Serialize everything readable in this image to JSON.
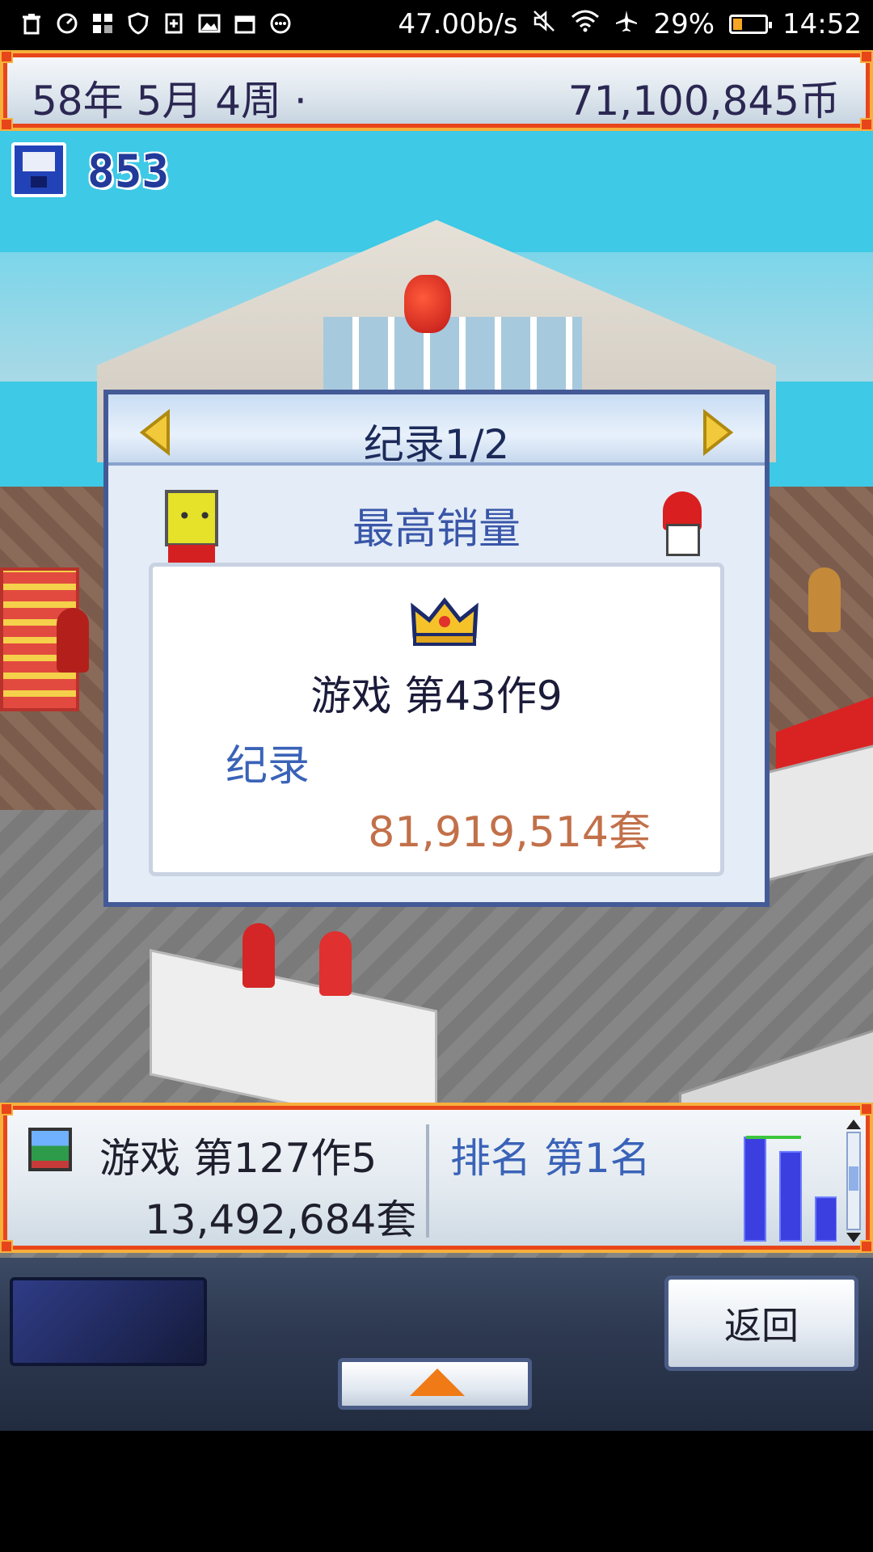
{
  "status_bar": {
    "network_speed": "47.00b/s",
    "battery_percent": "29%",
    "battery_level": 0.29,
    "time": "14:52",
    "left_icons": [
      "trash-icon",
      "speed-icon",
      "apps-icon",
      "shield-icon",
      "sim-add-icon",
      "image-icon",
      "calendar-icon",
      "more-icon"
    ],
    "right_icons": [
      "mute-icon",
      "wifi-icon",
      "airplane-icon",
      "battery-icon"
    ]
  },
  "top_bar": {
    "date": "58年 5月 4周 ·",
    "money": "71,100,845币"
  },
  "save": {
    "count": "853"
  },
  "record_dialog": {
    "title": "纪录1/2",
    "category": "最高销量",
    "game_name": "游戏 第43作9",
    "record_label": "纪录",
    "record_value": "81,919,514套",
    "prev_icon": "arrow-left-icon",
    "next_icon": "arrow-right-icon",
    "badge_icon": "crown-icon"
  },
  "bottom_bar": {
    "game_title": "游戏 第127作5",
    "sales": "13,492,684套",
    "rank": "排名 第1名",
    "chart_relative_levels": [
      1.0,
      0.86,
      0.42
    ]
  },
  "controls": {
    "back_label": "返回",
    "up_icon": "up-arrow-icon"
  },
  "colors": {
    "sky": "#3ec9e6",
    "frame_red": "#e8461a",
    "frame_gold": "#f7b03c",
    "title_navy": "#1c2a5a",
    "accent_blue": "#3a63b8",
    "record_orange": "#c2704a"
  }
}
